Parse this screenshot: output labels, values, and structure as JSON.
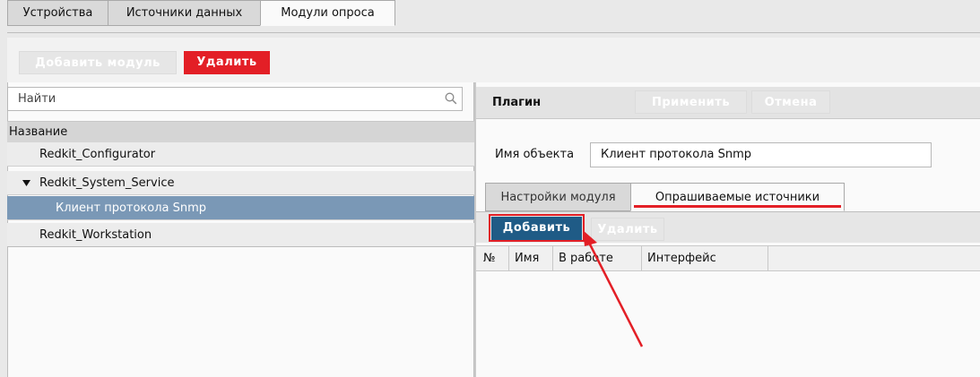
{
  "tabs": [
    "Устройства",
    "Источники данных",
    "Модули опроса"
  ],
  "toolbar": {
    "add_module": "Добавить модуль",
    "delete": "Удалить"
  },
  "search": {
    "placeholder": "Найти"
  },
  "list": {
    "header": "Название",
    "items": [
      "Redkit_Configurator",
      "Redkit_System_Service",
      "Клиент протокола Snmp",
      "Redkit_Workstation"
    ]
  },
  "plugin": {
    "title": "Плагин",
    "apply": "Применить",
    "cancel": "Отмена",
    "object_name_label": "Имя объекта",
    "object_name_value": "Клиент протокола Snmp"
  },
  "subtabs": [
    "Настройки модуля",
    "Опрашиваемые источники"
  ],
  "sources": {
    "add": "Добавить",
    "delete": "Удалить"
  },
  "table": {
    "columns": [
      "№",
      "Имя",
      "В работе",
      "Интерфейс"
    ]
  },
  "colors": {
    "accent_red": "#e31f26",
    "selected_row": "#7a98b6",
    "add_button": "#1f5b86"
  }
}
